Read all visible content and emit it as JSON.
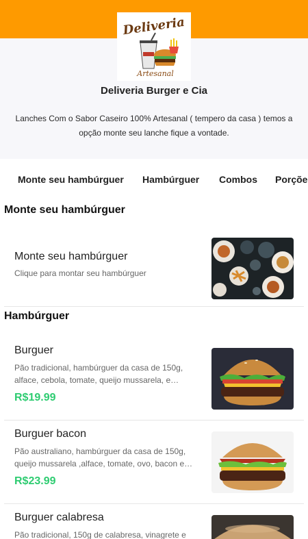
{
  "store": {
    "logo_title": "Deliveria",
    "logo_subtitle": "Artesanal",
    "name": "Deliveria Burger e Cia",
    "description": "Lanches Com o Sabor Caseiro 100% Artesanal ( tempero da casa ) temos a opção monte seu lanche fique a vontade.",
    "brand_color": "#fe9a00",
    "price_color": "#2ecc71"
  },
  "tabs": [
    "Monte seu hambúrguer",
    "Hambúrguer",
    "Combos",
    "Porções"
  ],
  "sections": [
    {
      "title": "Monte seu hambúrguer",
      "items": [
        {
          "name": "Monte seu hambúrguer",
          "description": "Clique para montar seu hambúrguer",
          "image": "table-of-burgers-photo"
        }
      ]
    },
    {
      "title": "Hambúrguer",
      "items": [
        {
          "name": "Burguer",
          "description": "Pão tradicional, hambúrguer da casa de 150g, alface, cebola, tomate, queijo mussarela, e maionese",
          "price": "R$19.99",
          "image": "burger-photo"
        },
        {
          "name": "Burguer bacon",
          "description": "Pão australiano, hambúrguer da casa de 150g, queijo mussarela ,alface, tomate, ovo, bacon e maionese",
          "price": "R$23.99",
          "image": "bacon-burger-photo"
        },
        {
          "name": "Burguer calabresa",
          "description": "Pão tradicional, 150g de calabresa, vinagrete e",
          "image": "calabresa-burger-photo"
        }
      ]
    }
  ]
}
